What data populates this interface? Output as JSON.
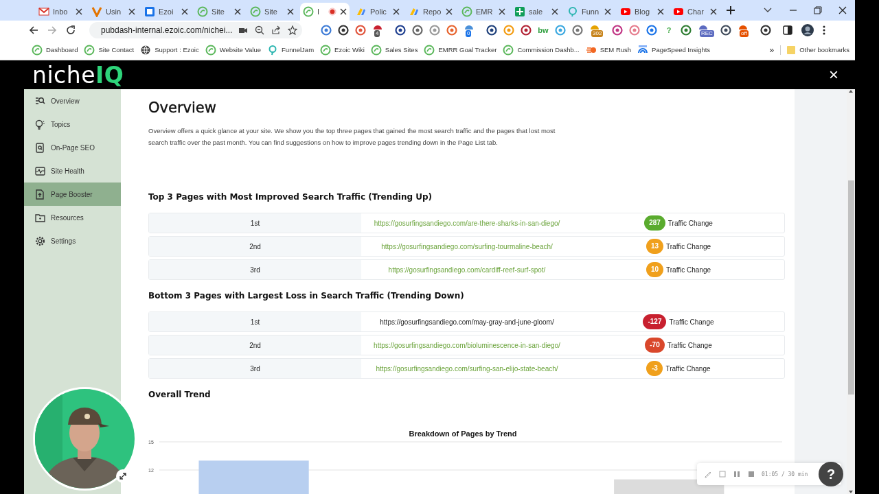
{
  "tabs": [
    {
      "label": "Inbo",
      "selected": false,
      "recording": false
    },
    {
      "label": "Usin",
      "selected": false,
      "recording": false
    },
    {
      "label": "Ezoi",
      "selected": false,
      "recording": false
    },
    {
      "label": "Site",
      "selected": false,
      "recording": false
    },
    {
      "label": "Site",
      "selected": false,
      "recording": false
    },
    {
      "label": "I",
      "selected": true,
      "recording": true
    },
    {
      "label": "Polic",
      "selected": false,
      "recording": false
    },
    {
      "label": "Repo",
      "selected": false,
      "recording": false
    },
    {
      "label": "EMR",
      "selected": false,
      "recording": false
    },
    {
      "label": "sale",
      "selected": false,
      "recording": false
    },
    {
      "label": "Funn",
      "selected": false,
      "recording": false
    },
    {
      "label": "Blog",
      "selected": false,
      "recording": false
    },
    {
      "label": "Char",
      "selected": false,
      "recording": false
    }
  ],
  "address_bar": {
    "url": "pubdash-internal.ezoic.com/nichei..."
  },
  "extensions": [
    {
      "kind": "icon"
    },
    {
      "kind": "icon"
    },
    {
      "kind": "icon"
    },
    {
      "kind": "badge",
      "badge": "4"
    },
    {
      "kind": "icon"
    },
    {
      "kind": "icon"
    },
    {
      "kind": "icon"
    },
    {
      "kind": "icon"
    },
    {
      "kind": "badge",
      "badge": "0"
    },
    {
      "kind": "icon"
    },
    {
      "kind": "icon"
    },
    {
      "kind": "icon"
    },
    {
      "kind": "text",
      "text": "bw"
    },
    {
      "kind": "icon"
    },
    {
      "kind": "icon"
    },
    {
      "kind": "badge",
      "badge": "302"
    },
    {
      "kind": "icon"
    },
    {
      "kind": "icon"
    },
    {
      "kind": "icon"
    },
    {
      "kind": "text",
      "text": "?"
    },
    {
      "kind": "icon"
    },
    {
      "kind": "badge",
      "badge": "REC"
    },
    {
      "kind": "icon"
    },
    {
      "kind": "badge",
      "badge": "off"
    },
    {
      "kind": "icon"
    }
  ],
  "bookmarks": [
    "Dashboard",
    "Site Contact",
    "Support : Ezoic",
    "Website Value",
    "FunnelJam",
    "Ezoic Wiki",
    "Sales Sites",
    "EMRR Goal Tracker",
    "Commission Dashb...",
    "SEM Rush",
    "PageSpeed Insights"
  ],
  "bookmarks_more": "»",
  "other_bookmarks": "Other bookmarks",
  "app": {
    "logo": {
      "text": "niche",
      "accent": "IQ"
    },
    "close": "×"
  },
  "sidebar": {
    "items": [
      {
        "label": "Overview",
        "selected": false
      },
      {
        "label": "Topics",
        "selected": false
      },
      {
        "label": "On-Page SEO",
        "selected": false
      },
      {
        "label": "Site Health",
        "selected": false
      },
      {
        "label": "Page Booster",
        "selected": true
      },
      {
        "label": "Resources",
        "selected": false
      },
      {
        "label": "Settings",
        "selected": false
      }
    ]
  },
  "page": {
    "title": "Overview",
    "intro": "Overview offers a quick glance at your site. We show you the top three pages that gained the most search traffic and the pages that lost most search traffic over the past month. You can find suggestions on how to improve pages trending down in the Page List tab.",
    "sections": [
      {
        "title": "Top 3 Pages with Most Improved Search Traffic (Trending Up)",
        "rows": [
          {
            "rank": "1st",
            "url": "https://gosurfingsandiego.com/are-there-sharks-in-san-diego/",
            "change": "287",
            "color": "#5aab2e",
            "label": "Traffic Change",
            "hovered": false
          },
          {
            "rank": "2nd",
            "url": "https://gosurfingsandiego.com/surfing-tourmaline-beach/",
            "change": "13",
            "color": "#f0a01c",
            "label": "Traffic Change",
            "hovered": false
          },
          {
            "rank": "3rd",
            "url": "https://gosurfingsandiego.com/cardiff-reef-surf-spot/",
            "change": "10",
            "color": "#f0a01c",
            "label": "Traffic Change",
            "hovered": false
          }
        ]
      },
      {
        "title": "Bottom 3 Pages with Largest Loss in Search Traffic (Trending Down)",
        "rows": [
          {
            "rank": "1st",
            "url": "https://gosurfingsandiego.com/may-gray-and-june-gloom/",
            "change": "-127",
            "color": "#c8202f",
            "label": "Traffic Change",
            "hovered": true
          },
          {
            "rank": "2nd",
            "url": "https://gosurfingsandiego.com/bioluminescence-in-san-diego/",
            "change": "-70",
            "color": "#d9472b",
            "label": "Traffic Change",
            "hovered": false
          },
          {
            "rank": "3rd",
            "url": "https://gosurfingsandiego.com/surfing-san-elijo-state-beach/",
            "change": "-3",
            "color": "#f0a01c",
            "label": "Traffic Change",
            "hovered": false
          }
        ]
      }
    ],
    "trend": {
      "title": "Overall Trend",
      "chart_data": {
        "type": "bar",
        "title": "Breakdown of Pages by Trend",
        "ylim": [
          0,
          15
        ],
        "yticks": [
          12,
          15
        ],
        "series": [
          {
            "color": "#b8cff0",
            "values": [
              13,
              null,
              null
            ]
          },
          {
            "color": "#dcdcdc",
            "values": [
              null,
              null,
              11
            ]
          }
        ]
      }
    }
  },
  "recorder": {
    "time": "01:05 / 30 min",
    "help": "?"
  }
}
